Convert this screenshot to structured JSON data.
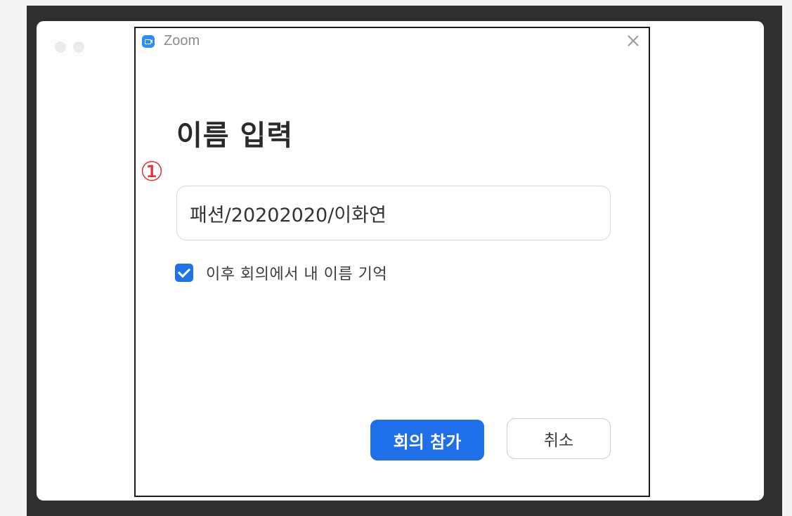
{
  "window": {
    "app_title": "Zoom",
    "app_icon": "zoom-camera-icon",
    "close_icon": "close-icon"
  },
  "dialog": {
    "heading": "이름 입력",
    "marker": "①",
    "name_value": "패션/20202020/이화연",
    "remember_checked": true,
    "remember_label": "이후 회의에서 내 이름 기억",
    "join_button": "회의 참가",
    "cancel_button": "취소"
  },
  "colors": {
    "accent": "#1f6feb",
    "marker": "#e6313a",
    "zoom_brand": "#2d8cff"
  }
}
